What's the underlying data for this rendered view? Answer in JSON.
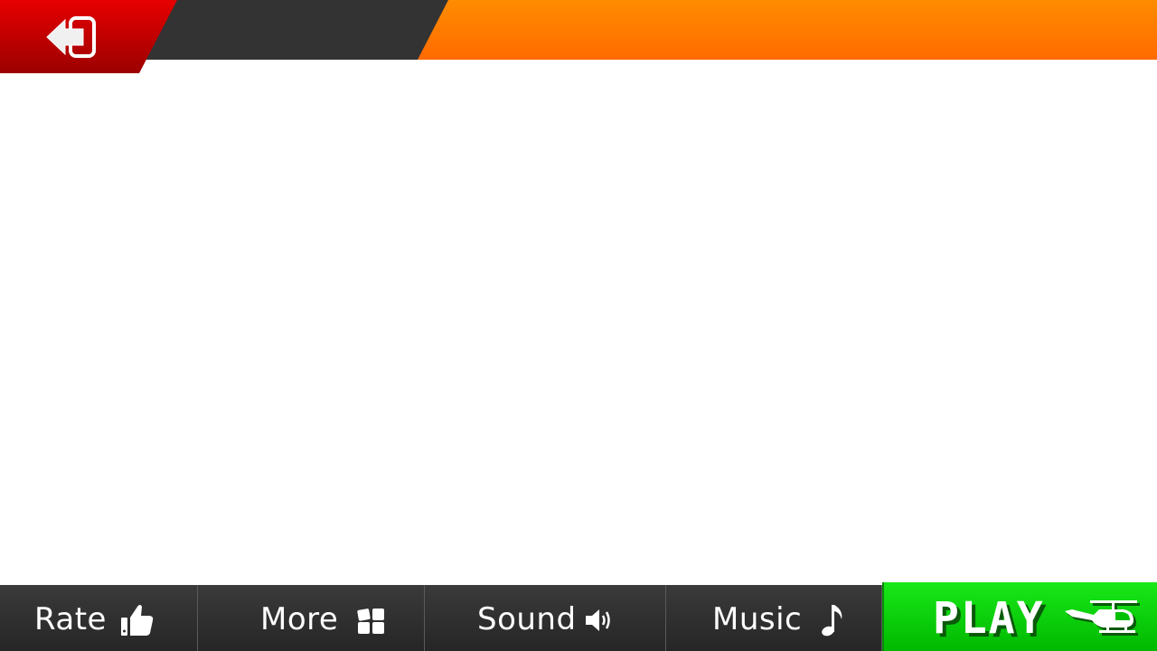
{
  "header": {
    "back_icon": "exit-arrow-icon"
  },
  "bottom_bar": {
    "rate": {
      "label": "Rate",
      "icon": "thumbs-up-icon"
    },
    "more": {
      "label": "More",
      "icon": "grid-icon"
    },
    "sound": {
      "label": "Sound",
      "icon": "speaker-icon"
    },
    "music": {
      "label": "Music",
      "icon": "music-note-icon"
    },
    "play": {
      "label": "PLAY",
      "icon": "helicopter-icon"
    }
  },
  "colors": {
    "back_red": "#e60000",
    "header_dark": "#333333",
    "header_orange": "#ff7a00",
    "nav_dark": "#2e2e2e",
    "play_green": "#18e818"
  }
}
